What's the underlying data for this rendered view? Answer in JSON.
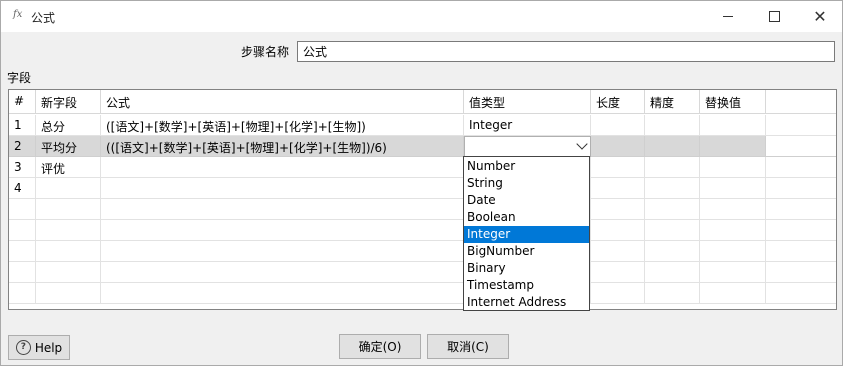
{
  "window": {
    "title_icon": "fx",
    "title": "公式"
  },
  "step": {
    "label": "步骤名称",
    "value": "公式"
  },
  "fields_label": "字段",
  "grid": {
    "columns": [
      "#",
      "新字段",
      "公式",
      "值类型",
      "长度",
      "精度",
      "替换值"
    ],
    "rows": [
      {
        "num": "1",
        "field": "总分",
        "formula": "([语文]+[数学]+[英语]+[物理]+[化学]+[生物])",
        "type": "Integer"
      },
      {
        "num": "2",
        "field": "平均分",
        "formula": "(([语文]+[数学]+[英语]+[物理]+[化学]+[生物])/6)",
        "type": ""
      },
      {
        "num": "3",
        "field": "评优",
        "formula": "",
        "type": ""
      },
      {
        "num": "4",
        "field": "",
        "formula": "",
        "type": ""
      }
    ]
  },
  "dropdown": {
    "options": [
      "Number",
      "String",
      "Date",
      "Boolean",
      "Integer",
      "BigNumber",
      "Binary",
      "Timestamp",
      "Internet Address"
    ],
    "selected": "Integer"
  },
  "buttons": {
    "help": "Help",
    "ok": "确定(O)",
    "cancel": "取消(C)"
  },
  "colors": {
    "selection": "#0078d7",
    "selected_row": "#d8d8d8"
  }
}
